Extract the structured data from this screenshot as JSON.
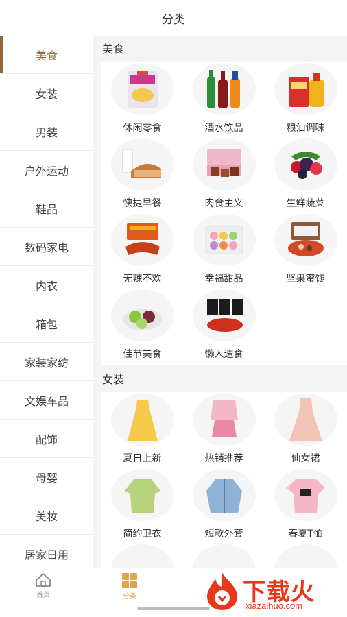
{
  "header": {
    "title": "分类"
  },
  "sidebar": {
    "items": [
      {
        "label": "美食",
        "active": true
      },
      {
        "label": "女装"
      },
      {
        "label": "男装"
      },
      {
        "label": "户外运动"
      },
      {
        "label": "鞋品"
      },
      {
        "label": "数码家电"
      },
      {
        "label": "内衣"
      },
      {
        "label": "箱包"
      },
      {
        "label": "家装家纺"
      },
      {
        "label": "文娱车品"
      },
      {
        "label": "配饰"
      },
      {
        "label": "母婴"
      },
      {
        "label": "美妆"
      },
      {
        "label": "居家日用"
      }
    ]
  },
  "main": {
    "sections": [
      {
        "title": "美食",
        "items": [
          {
            "label": "休闲零食",
            "icon": "snack-bag-icon"
          },
          {
            "label": "酒水饮品",
            "icon": "drink-bottles-icon"
          },
          {
            "label": "粮油调味",
            "icon": "oil-rice-icon"
          },
          {
            "label": "快捷早餐",
            "icon": "bread-milk-icon"
          },
          {
            "label": "肉食主义",
            "icon": "meat-box-icon"
          },
          {
            "label": "生鲜蔬菜",
            "icon": "berries-icon"
          },
          {
            "label": "无辣不欢",
            "icon": "spicy-snack-icon"
          },
          {
            "label": "幸福甜品",
            "icon": "macaron-icon"
          },
          {
            "label": "坚果蜜饯",
            "icon": "nuts-box-icon"
          },
          {
            "label": "佳节美食",
            "icon": "rice-cake-icon"
          },
          {
            "label": "懒人速食",
            "icon": "instant-noodle-icon"
          }
        ]
      },
      {
        "title": "女装",
        "items": [
          {
            "label": "夏日上新",
            "icon": "yellow-dress-icon"
          },
          {
            "label": "热销推荐",
            "icon": "pink-outfit-icon"
          },
          {
            "label": "仙女裙",
            "icon": "fairy-dress-icon"
          },
          {
            "label": "简约卫衣",
            "icon": "green-hoodie-icon"
          },
          {
            "label": "短款外套",
            "icon": "denim-jacket-icon"
          },
          {
            "label": "春夏T恤",
            "icon": "pink-tshirt-icon"
          }
        ]
      }
    ]
  },
  "tabbar": {
    "tabs": [
      {
        "label": "首页",
        "icon": "home-icon"
      },
      {
        "label": "分类",
        "icon": "category-grid-icon",
        "active": true
      },
      {
        "label": "",
        "icon": ""
      },
      {
        "label": "",
        "icon": ""
      }
    ]
  },
  "watermark": {
    "text": "下载火",
    "sub": "xiazaihuo.com"
  },
  "colors": {
    "accent": "#8c6a36",
    "tab_active": "#e0a64e",
    "watermark": "#e8381c"
  }
}
